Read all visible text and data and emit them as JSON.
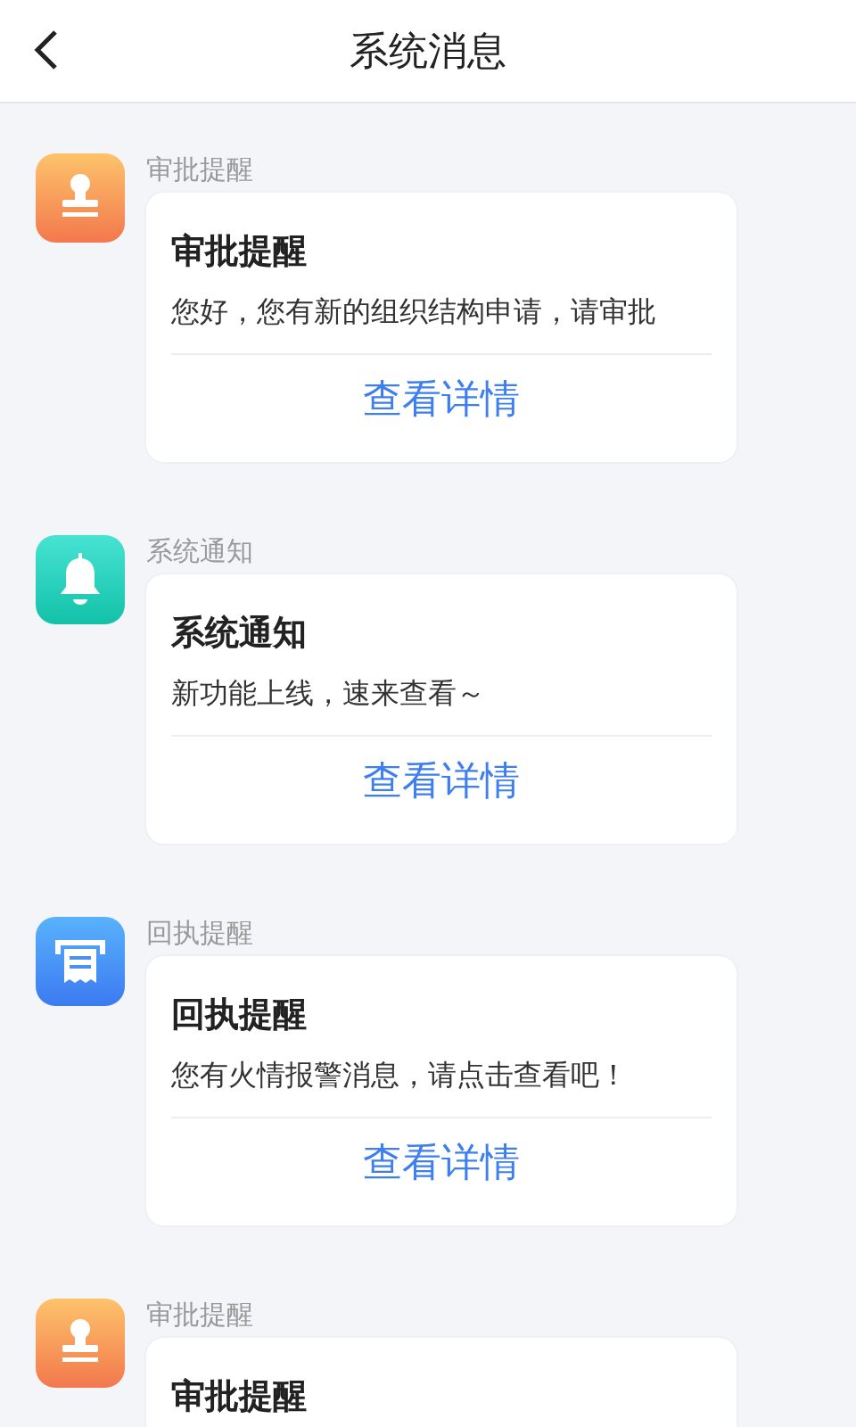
{
  "header": {
    "title": "系统消息"
  },
  "messages": [
    {
      "kind": "approval",
      "category": "审批提醒",
      "title": "审批提醒",
      "body": "您好，您有新的组织结构申请，请审批",
      "action": "查看详情"
    },
    {
      "kind": "system",
      "category": "系统通知",
      "title": "系统通知",
      "body": "新功能上线，速来查看～",
      "action": "查看详情"
    },
    {
      "kind": "receipt",
      "category": "回执提醒",
      "title": "回执提醒",
      "body": "您有火情报警消息，请点击查看吧！",
      "action": "查看详情"
    },
    {
      "kind": "approval",
      "category": "审批提醒",
      "title": "审批提醒"
    }
  ]
}
